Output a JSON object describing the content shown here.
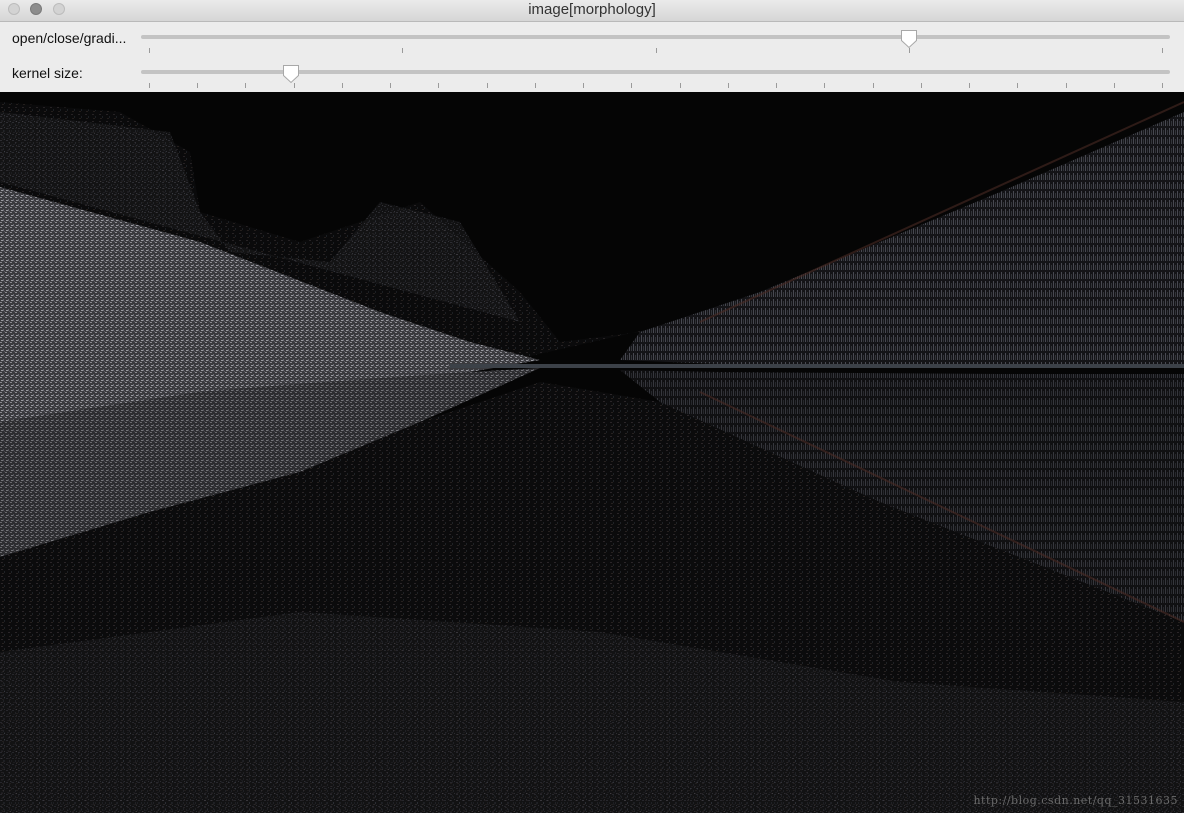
{
  "window": {
    "title": "image[morphology]",
    "buttons": [
      "close-button",
      "minimize-button",
      "zoom-button"
    ]
  },
  "trackbars": [
    {
      "label": "open/close/gradi...",
      "value_fraction": 0.75,
      "tick_count": 5
    },
    {
      "label": "kernel size:",
      "value_fraction": 0.14,
      "tick_count": 22
    }
  ],
  "image": {
    "description_free": true,
    "watermark": "http://blog.csdn.net/qq_31531635"
  },
  "colors": {
    "titlebar": "#dcdcdc",
    "panel": "#ececec",
    "track": "#c3c3c3",
    "image_bg": "#060606"
  }
}
